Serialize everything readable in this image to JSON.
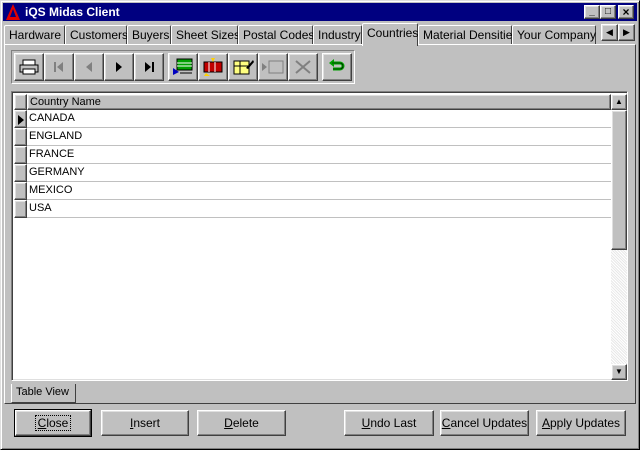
{
  "window": {
    "title": "iQS Midas Client",
    "minimize_glyph": "_",
    "maximize_glyph": "□",
    "close_glyph": "×"
  },
  "tabs": [
    {
      "label": "Hardware",
      "active": false
    },
    {
      "label": "Customers",
      "active": false
    },
    {
      "label": "Buyers",
      "active": false
    },
    {
      "label": "Sheet Sizes",
      "active": false
    },
    {
      "label": "Postal Codes",
      "active": false
    },
    {
      "label": "Industry",
      "active": false
    },
    {
      "label": "Countries",
      "active": true
    },
    {
      "label": "Material Densities",
      "active": false
    },
    {
      "label": "Your Company",
      "active": false
    }
  ],
  "toolbar": {
    "buttons": [
      {
        "name": "print-icon",
        "enabled": true
      },
      {
        "name": "first-record-icon",
        "enabled": false
      },
      {
        "name": "prior-record-icon",
        "enabled": false
      },
      {
        "name": "next-record-icon",
        "enabled": true
      },
      {
        "name": "last-record-icon",
        "enabled": true
      },
      {
        "name": "insert-record-icon",
        "enabled": true
      },
      {
        "name": "delete-record-icon",
        "enabled": true
      },
      {
        "name": "edit-record-icon",
        "enabled": true
      },
      {
        "name": "post-edit-icon",
        "enabled": false
      },
      {
        "name": "cancel-edit-icon",
        "enabled": false
      },
      {
        "name": "refresh-icon",
        "enabled": true
      }
    ]
  },
  "grid": {
    "column_header": "Country Name",
    "current_row": 0,
    "rows": [
      "CANADA",
      "ENGLAND",
      "FRANCE",
      "GERMANY",
      "MEXICO",
      "USA"
    ]
  },
  "view_tab": {
    "label": "Table View"
  },
  "buttons": {
    "close": {
      "accel": "C",
      "rest": "lose"
    },
    "insert": {
      "accel": "I",
      "rest": "nsert"
    },
    "delete": {
      "accel": "D",
      "rest": "elete"
    },
    "undo_last": {
      "accel": "U",
      "rest": "ndo Last"
    },
    "cancel_updates": {
      "accel": "C",
      "rest": "ancel Updates"
    },
    "apply_updates": {
      "accel": "A",
      "rest": "pply Updates"
    }
  },
  "colors": {
    "titlebar": "#000080",
    "face": "#c0c0c0",
    "grid_background": "#ffffff"
  }
}
